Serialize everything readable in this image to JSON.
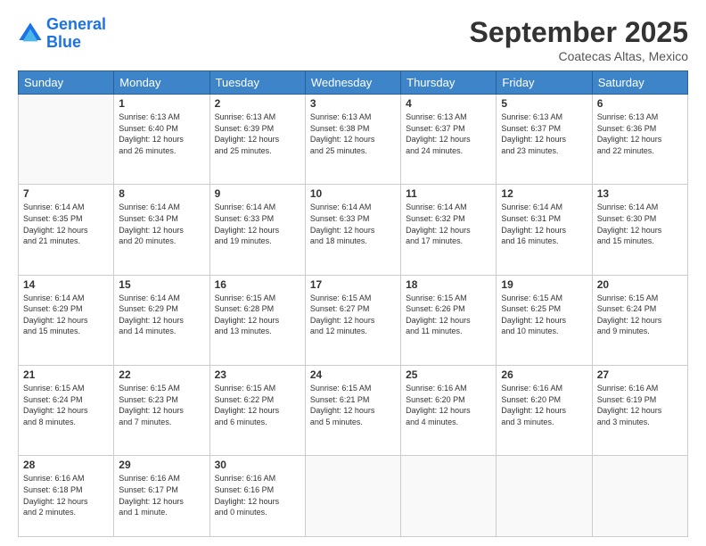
{
  "header": {
    "logo_line1": "General",
    "logo_line2": "Blue",
    "month": "September 2025",
    "location": "Coatecas Altas, Mexico"
  },
  "weekdays": [
    "Sunday",
    "Monday",
    "Tuesday",
    "Wednesday",
    "Thursday",
    "Friday",
    "Saturday"
  ],
  "weeks": [
    [
      {
        "day": "",
        "info": ""
      },
      {
        "day": "1",
        "info": "Sunrise: 6:13 AM\nSunset: 6:40 PM\nDaylight: 12 hours\nand 26 minutes."
      },
      {
        "day": "2",
        "info": "Sunrise: 6:13 AM\nSunset: 6:39 PM\nDaylight: 12 hours\nand 25 minutes."
      },
      {
        "day": "3",
        "info": "Sunrise: 6:13 AM\nSunset: 6:38 PM\nDaylight: 12 hours\nand 25 minutes."
      },
      {
        "day": "4",
        "info": "Sunrise: 6:13 AM\nSunset: 6:37 PM\nDaylight: 12 hours\nand 24 minutes."
      },
      {
        "day": "5",
        "info": "Sunrise: 6:13 AM\nSunset: 6:37 PM\nDaylight: 12 hours\nand 23 minutes."
      },
      {
        "day": "6",
        "info": "Sunrise: 6:13 AM\nSunset: 6:36 PM\nDaylight: 12 hours\nand 22 minutes."
      }
    ],
    [
      {
        "day": "7",
        "info": "Sunrise: 6:14 AM\nSunset: 6:35 PM\nDaylight: 12 hours\nand 21 minutes."
      },
      {
        "day": "8",
        "info": "Sunrise: 6:14 AM\nSunset: 6:34 PM\nDaylight: 12 hours\nand 20 minutes."
      },
      {
        "day": "9",
        "info": "Sunrise: 6:14 AM\nSunset: 6:33 PM\nDaylight: 12 hours\nand 19 minutes."
      },
      {
        "day": "10",
        "info": "Sunrise: 6:14 AM\nSunset: 6:33 PM\nDaylight: 12 hours\nand 18 minutes."
      },
      {
        "day": "11",
        "info": "Sunrise: 6:14 AM\nSunset: 6:32 PM\nDaylight: 12 hours\nand 17 minutes."
      },
      {
        "day": "12",
        "info": "Sunrise: 6:14 AM\nSunset: 6:31 PM\nDaylight: 12 hours\nand 16 minutes."
      },
      {
        "day": "13",
        "info": "Sunrise: 6:14 AM\nSunset: 6:30 PM\nDaylight: 12 hours\nand 15 minutes."
      }
    ],
    [
      {
        "day": "14",
        "info": "Sunrise: 6:14 AM\nSunset: 6:29 PM\nDaylight: 12 hours\nand 15 minutes."
      },
      {
        "day": "15",
        "info": "Sunrise: 6:14 AM\nSunset: 6:29 PM\nDaylight: 12 hours\nand 14 minutes."
      },
      {
        "day": "16",
        "info": "Sunrise: 6:15 AM\nSunset: 6:28 PM\nDaylight: 12 hours\nand 13 minutes."
      },
      {
        "day": "17",
        "info": "Sunrise: 6:15 AM\nSunset: 6:27 PM\nDaylight: 12 hours\nand 12 minutes."
      },
      {
        "day": "18",
        "info": "Sunrise: 6:15 AM\nSunset: 6:26 PM\nDaylight: 12 hours\nand 11 minutes."
      },
      {
        "day": "19",
        "info": "Sunrise: 6:15 AM\nSunset: 6:25 PM\nDaylight: 12 hours\nand 10 minutes."
      },
      {
        "day": "20",
        "info": "Sunrise: 6:15 AM\nSunset: 6:24 PM\nDaylight: 12 hours\nand 9 minutes."
      }
    ],
    [
      {
        "day": "21",
        "info": "Sunrise: 6:15 AM\nSunset: 6:24 PM\nDaylight: 12 hours\nand 8 minutes."
      },
      {
        "day": "22",
        "info": "Sunrise: 6:15 AM\nSunset: 6:23 PM\nDaylight: 12 hours\nand 7 minutes."
      },
      {
        "day": "23",
        "info": "Sunrise: 6:15 AM\nSunset: 6:22 PM\nDaylight: 12 hours\nand 6 minutes."
      },
      {
        "day": "24",
        "info": "Sunrise: 6:15 AM\nSunset: 6:21 PM\nDaylight: 12 hours\nand 5 minutes."
      },
      {
        "day": "25",
        "info": "Sunrise: 6:16 AM\nSunset: 6:20 PM\nDaylight: 12 hours\nand 4 minutes."
      },
      {
        "day": "26",
        "info": "Sunrise: 6:16 AM\nSunset: 6:20 PM\nDaylight: 12 hours\nand 3 minutes."
      },
      {
        "day": "27",
        "info": "Sunrise: 6:16 AM\nSunset: 6:19 PM\nDaylight: 12 hours\nand 3 minutes."
      }
    ],
    [
      {
        "day": "28",
        "info": "Sunrise: 6:16 AM\nSunset: 6:18 PM\nDaylight: 12 hours\nand 2 minutes."
      },
      {
        "day": "29",
        "info": "Sunrise: 6:16 AM\nSunset: 6:17 PM\nDaylight: 12 hours\nand 1 minute."
      },
      {
        "day": "30",
        "info": "Sunrise: 6:16 AM\nSunset: 6:16 PM\nDaylight: 12 hours\nand 0 minutes."
      },
      {
        "day": "",
        "info": ""
      },
      {
        "day": "",
        "info": ""
      },
      {
        "day": "",
        "info": ""
      },
      {
        "day": "",
        "info": ""
      }
    ]
  ]
}
